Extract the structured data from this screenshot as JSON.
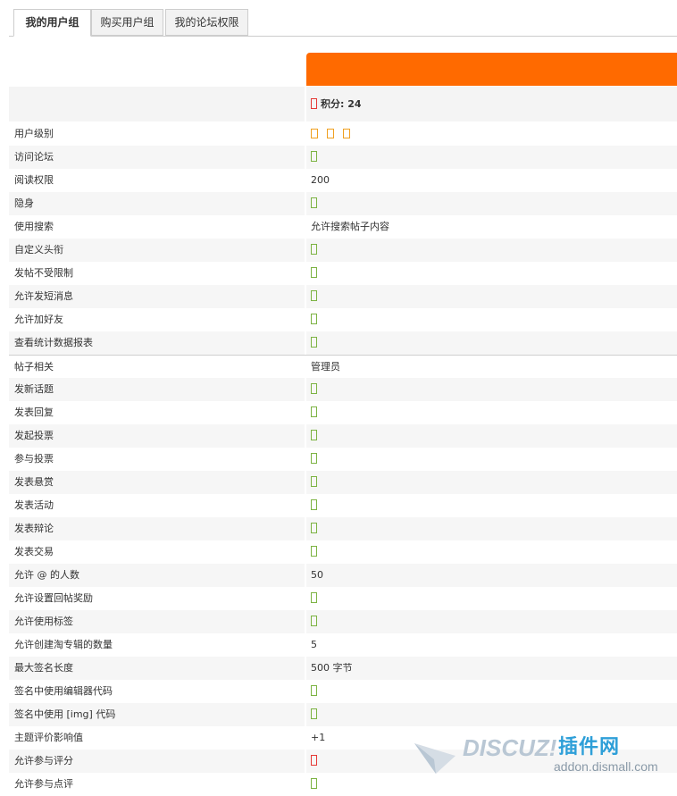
{
  "tabs": [
    {
      "label": "我的用户组",
      "active": true
    },
    {
      "label": "购买用户组",
      "active": false
    },
    {
      "label": "我的论坛权限",
      "active": false
    }
  ],
  "score": {
    "label": "积分: 24"
  },
  "rows": [
    {
      "label": "用户级别",
      "type": "stars",
      "value": "",
      "stars": 3
    },
    {
      "label": "访问论坛",
      "type": "tick",
      "value": ""
    },
    {
      "label": "阅读权限",
      "type": "text",
      "value": "200"
    },
    {
      "label": "隐身",
      "type": "tick",
      "value": ""
    },
    {
      "label": "使用搜索",
      "type": "text",
      "value": "允许搜索帖子内容"
    },
    {
      "label": "自定义头衔",
      "type": "tick",
      "value": ""
    },
    {
      "label": "发帖不受限制",
      "type": "tick",
      "value": ""
    },
    {
      "label": "允许发短消息",
      "type": "tick",
      "value": ""
    },
    {
      "label": "允许加好友",
      "type": "tick",
      "value": ""
    },
    {
      "label": "查看统计数据报表",
      "type": "tick",
      "value": ""
    },
    {
      "label": "帖子相关",
      "type": "text",
      "value": "管理员",
      "section": true
    },
    {
      "label": "发新话题",
      "type": "tick",
      "value": ""
    },
    {
      "label": "发表回复",
      "type": "tick",
      "value": ""
    },
    {
      "label": "发起投票",
      "type": "tick",
      "value": ""
    },
    {
      "label": "参与投票",
      "type": "tick",
      "value": ""
    },
    {
      "label": "发表悬赏",
      "type": "tick",
      "value": ""
    },
    {
      "label": "发表活动",
      "type": "tick",
      "value": ""
    },
    {
      "label": "发表辩论",
      "type": "tick",
      "value": ""
    },
    {
      "label": "发表交易",
      "type": "tick",
      "value": ""
    },
    {
      "label": "允许 @ 的人数",
      "type": "text",
      "value": "50"
    },
    {
      "label": "允许设置回帖奖励",
      "type": "tick",
      "value": ""
    },
    {
      "label": "允许使用标签",
      "type": "tick",
      "value": ""
    },
    {
      "label": "允许创建淘专辑的数量",
      "type": "text",
      "value": "5"
    },
    {
      "label": "最大签名长度",
      "type": "text",
      "value": "500 字节"
    },
    {
      "label": "签名中使用编辑器代码",
      "type": "tick",
      "value": ""
    },
    {
      "label": "签名中使用 [img] 代码",
      "type": "tick",
      "value": ""
    },
    {
      "label": "主题评价影响值",
      "type": "text",
      "value": "+1"
    },
    {
      "label": "允许参与评分",
      "type": "cross",
      "value": ""
    },
    {
      "label": "允许参与点评",
      "type": "tick",
      "value": ""
    }
  ],
  "watermark": {
    "logo": "DISCUZ!",
    "cn": "插件网",
    "url": "addon.dismall.com"
  }
}
